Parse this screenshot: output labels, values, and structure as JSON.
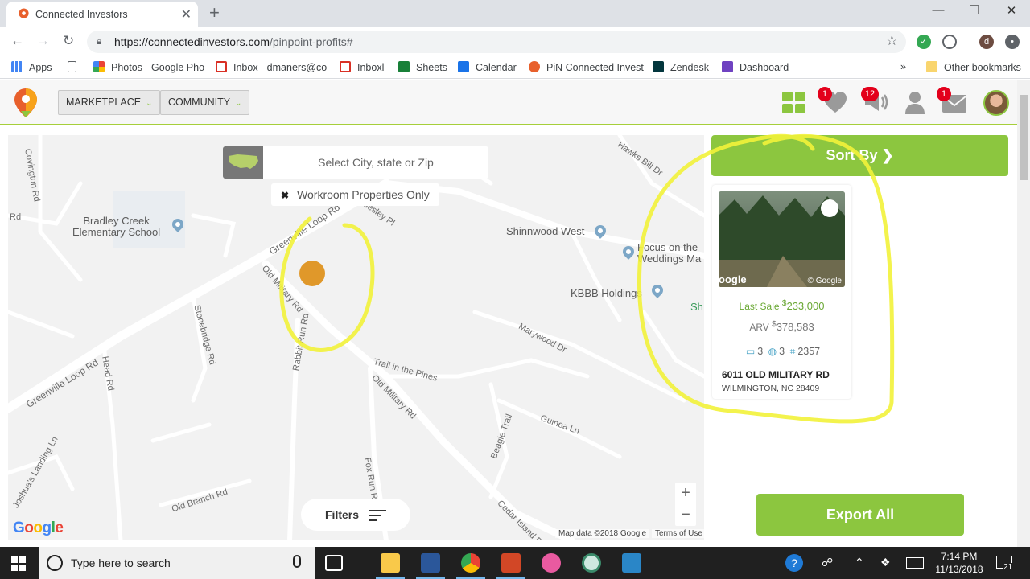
{
  "browser": {
    "tab_title": "Connected Investors",
    "new_tab": "+",
    "tab_close": "✕",
    "window_controls": [
      "—",
      "❐",
      "✕"
    ],
    "url_host": "https://connectedinvestors.com",
    "url_path": "/pinpoint-profits#",
    "profile_initial": "d"
  },
  "bookmarks": {
    "items": [
      {
        "label": "Apps",
        "color": "#4285f4"
      },
      {
        "label": "",
        "color": "#9aa0a6"
      },
      {
        "label": "Photos - Google Pho",
        "color": "#fbbc04"
      },
      {
        "label": "Inbox - dmaners@co",
        "color": "#d93025"
      },
      {
        "label": "Inboxl",
        "color": "#d93025"
      },
      {
        "label": "Sheets",
        "color": "#188038"
      },
      {
        "label": "Calendar",
        "color": "#1a73e8"
      },
      {
        "label": "PiN Connected Invest",
        "color": "#e8602c"
      },
      {
        "label": "Zendesk",
        "color": "#03363d"
      },
      {
        "label": "Dashboard",
        "color": "#6f42c1"
      }
    ],
    "overflow": "»",
    "other": "Other bookmarks"
  },
  "app_header": {
    "marketplace_label": "MARKETPLACE",
    "community_label": "COMMUNITY",
    "favorites_badge": "1",
    "notifications_badge": "12",
    "messages_badge": "1"
  },
  "map": {
    "search_placeholder": "Select City, state or Zip",
    "workroom_label": "Workroom Properties Only",
    "filters_label": "Filters",
    "zoom_in": "+",
    "zoom_out": "−",
    "google_logo": "Google",
    "attribution": "Map data ©2018 Google",
    "terms": "Terms of Use",
    "places": [
      {
        "name": "Bradley Creek\nElementary School"
      },
      {
        "name": "Shinnwood West"
      },
      {
        "name": "Focus on the\nWeddings Ma"
      },
      {
        "name": "KBBB Holdings"
      },
      {
        "name": "Sh"
      }
    ],
    "streets": [
      "Covington Rd",
      "Hawks Bill Dr",
      "Greenville Loop Rd",
      "Old Military Rd",
      "Rabbit Run Rd",
      "Stonebridge Rd",
      "Head Rd",
      "Greenville Loop Rd",
      "Trail in the Pines",
      "Old Military Rd",
      "Marywood Dr",
      "Guinea Ln",
      "Beagle Trail",
      "Fox Run Rd",
      "Old Branch Rd",
      "Cedar Island Rd",
      "Rd",
      "Joshua's Landing Ln",
      "uesley Pl"
    ]
  },
  "panel": {
    "sort_by": "Sort By",
    "sort_arrow": "❯",
    "photo_google": "oogle",
    "photo_copyright": "© Google",
    "last_sale_label": "Last Sale",
    "last_sale_currency": "$",
    "last_sale_value": "233,000",
    "arv_label": "ARV",
    "arv_currency": "$",
    "arv_value": "378,583",
    "beds": "3",
    "baths": "3",
    "sqft": "2357",
    "address_line1": "6011 OLD MILITARY RD",
    "address_line2": "WILMINGTON, NC 28409",
    "export_all": "Export All"
  },
  "taskbar": {
    "search_placeholder": "Type here to search",
    "time": "7:14 PM",
    "date": "11/13/2018",
    "notification_count": "21"
  },
  "colors": {
    "accent_green": "#8cc63f",
    "badge_red": "#e3001b",
    "marker_orange": "#e0982a",
    "annotation_yellow": "#f2f23a"
  }
}
